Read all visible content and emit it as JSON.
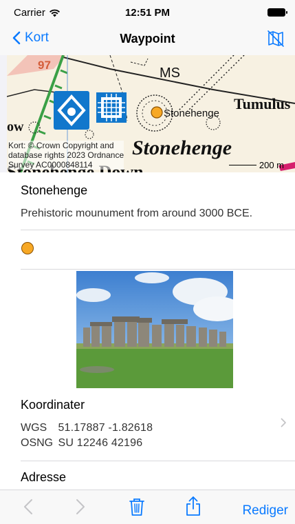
{
  "status": {
    "carrier": "Carrier",
    "time": "12:51 PM"
  },
  "nav": {
    "back_label": "Kort",
    "title": "Waypoint"
  },
  "map": {
    "labels": {
      "ms": "MS",
      "tumulus": "Tumulus",
      "stonehenge_small": "Stonehenge",
      "stonehenge_big": "Stonehenge",
      "road_number": "97",
      "partial_bottom": "Stonehenge Down",
      "partial_left": "ow"
    },
    "credit": [
      "Kort: © Crown Copyright and",
      "database rights 2023 Ordnance",
      "Survey AC0000848114"
    ],
    "scale": "200 m"
  },
  "waypoint": {
    "name": "Stonehenge",
    "description": "Prehistoric mounument from around 3000 BCE.",
    "pin_color": "#f7a825"
  },
  "coordinates": {
    "title": "Koordinater",
    "rows": [
      {
        "label": "WGS",
        "value": "51.17887  -1.82618"
      },
      {
        "label": "OSNG",
        "value": "SU 12246 42196"
      }
    ]
  },
  "address": {
    "title": "Adresse"
  },
  "toolbar": {
    "edit_label": "Rediger"
  },
  "colors": {
    "accent": "#0a7aff",
    "map_blue": "#1177cc"
  }
}
